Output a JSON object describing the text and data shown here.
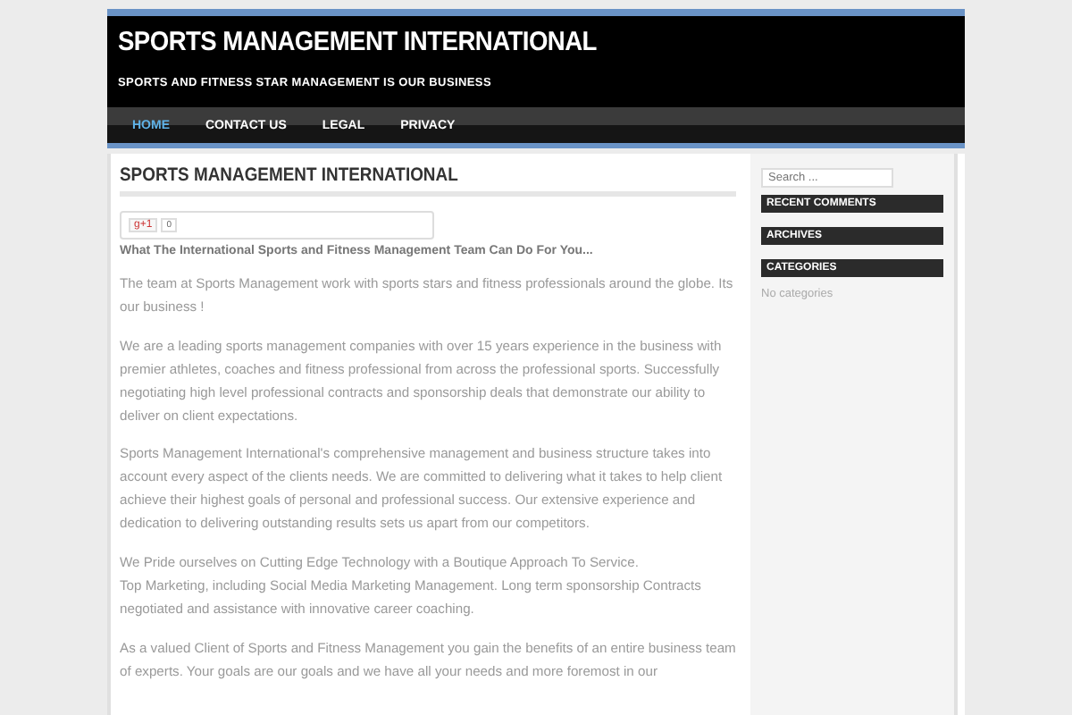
{
  "header": {
    "title": "SPORTS MANAGEMENT INTERNATIONAL",
    "tagline": "SPORTS AND FITNESS STAR MANAGEMENT IS OUR BUSINESS"
  },
  "nav": [
    {
      "label": "HOME",
      "selected": true
    },
    {
      "label": "CONTACT US",
      "selected": false
    },
    {
      "label": "LEGAL",
      "selected": false
    },
    {
      "label": "PRIVACY",
      "selected": false
    }
  ],
  "post": {
    "title": "SPORTS MANAGEMENT INTERNATIONAL",
    "share": {
      "button": "g+1",
      "count": "0"
    },
    "lead": "What The International Sports and Fitness Management Team Can Do For You...",
    "paragraphs": [
      [
        "The team at Sports Management work with sports stars and fitness professionals around the globe. Its our business !"
      ],
      [
        "We are a leading sports management companies with over 15 years experience in the business with premier athletes, coaches and fitness professional from across the professional sports. Successfully negotiating high level professional contracts and sponsorship deals that demonstrate our ability to deliver on client expectations."
      ],
      [
        "Sports Management International's comprehensive management and business structure takes into account every aspect of the clients needs. We are committed to delivering what it takes to help client achieve their highest goals of personal and professional success. Our extensive experience and dedication to delivering outstanding results sets us apart from our competitors."
      ],
      [
        "We Pride ourselves on Cutting Edge Technology with a Boutique Approach To Service.",
        "Top Marketing, including Social Media Marketing Management. Long term sponsorship Contracts negotiated and assistance with innovative career coaching."
      ],
      [
        "As a valued Client of Sports and Fitness Management you gain the benefits of an entire business team of experts. Your goals are our goals and we have all your needs and more foremost in our"
      ]
    ]
  },
  "sidebar": {
    "search": {
      "placeholder": "Search ..."
    },
    "widgets": [
      {
        "title": "RECENT COMMENTS"
      },
      {
        "title": "ARCHIVES"
      },
      {
        "title": "CATEGORIES",
        "text": "No categories"
      }
    ]
  }
}
